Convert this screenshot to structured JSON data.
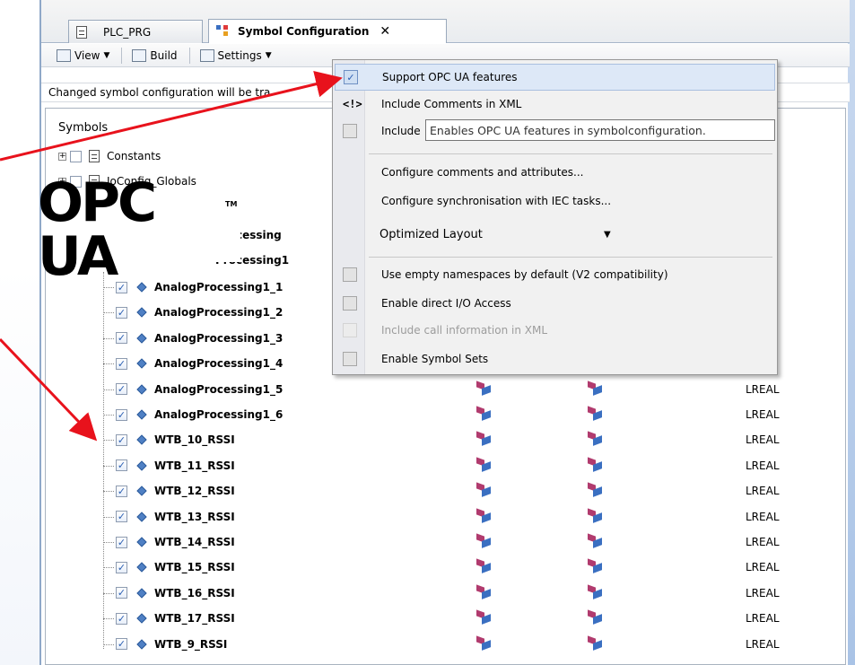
{
  "tabs": [
    {
      "label": "PLC_PRG",
      "active": false
    },
    {
      "label": "Symbol Configuration",
      "active": true
    }
  ],
  "toolbar": {
    "view_label": "View",
    "build_label": "Build",
    "settings_label": "Settings"
  },
  "infobar": {
    "text": "Changed symbol configuration will be tra"
  },
  "tree": {
    "header": "Symbols",
    "top_items": [
      {
        "label": "Constants"
      },
      {
        "label": "IoConfig_Globals"
      }
    ],
    "partial_items": [
      {
        "label": "Processing"
      },
      {
        "label": "Processing1"
      }
    ],
    "rows": [
      {
        "name": "AnalogProcessing1_1",
        "type": ""
      },
      {
        "name": "AnalogProcessing1_2",
        "type": ""
      },
      {
        "name": "AnalogProcessing1_3",
        "type": ""
      },
      {
        "name": "AnalogProcessing1_4",
        "type": ""
      },
      {
        "name": "AnalogProcessing1_5",
        "type": "LREAL"
      },
      {
        "name": "AnalogProcessing1_6",
        "type": "LREAL"
      },
      {
        "name": "WTB_10_RSSI",
        "type": "LREAL"
      },
      {
        "name": "WTB_11_RSSI",
        "type": "LREAL"
      },
      {
        "name": "WTB_12_RSSI",
        "type": "LREAL"
      },
      {
        "name": "WTB_13_RSSI",
        "type": "LREAL"
      },
      {
        "name": "WTB_14_RSSI",
        "type": "LREAL"
      },
      {
        "name": "WTB_15_RSSI",
        "type": "LREAL"
      },
      {
        "name": "WTB_16_RSSI",
        "type": "LREAL"
      },
      {
        "name": "WTB_17_RSSI",
        "type": "LREAL"
      },
      {
        "name": "WTB_9_RSSI",
        "type": "LREAL"
      }
    ]
  },
  "logo": {
    "text": "OPC UA",
    "tm": "TM"
  },
  "menu": {
    "items": [
      {
        "label": "Support OPC UA features",
        "checked": true
      },
      {
        "label": "Include Comments in XML",
        "glyph": "<!>"
      },
      {
        "label": "Include",
        "checked": false
      },
      {
        "label": "Configure comments and attributes..."
      },
      {
        "label": "Configure synchronisation with IEC tasks..."
      },
      {
        "label": "Use empty namespaces by default (V2 compatibility)",
        "checked": false
      },
      {
        "label": "Enable direct I/O Access",
        "checked": false
      },
      {
        "label": "Include call information in XML",
        "disabled": true
      },
      {
        "label": "Enable Symbol Sets",
        "checked": false
      }
    ],
    "layout_select": "Optimized Layout"
  },
  "tooltip": {
    "text": "Enables OPC UA features in symbolconfiguration."
  },
  "colors": {
    "arrow": "#e8121c",
    "highlight": "#dde8f7",
    "check": "#2b5fb3"
  }
}
